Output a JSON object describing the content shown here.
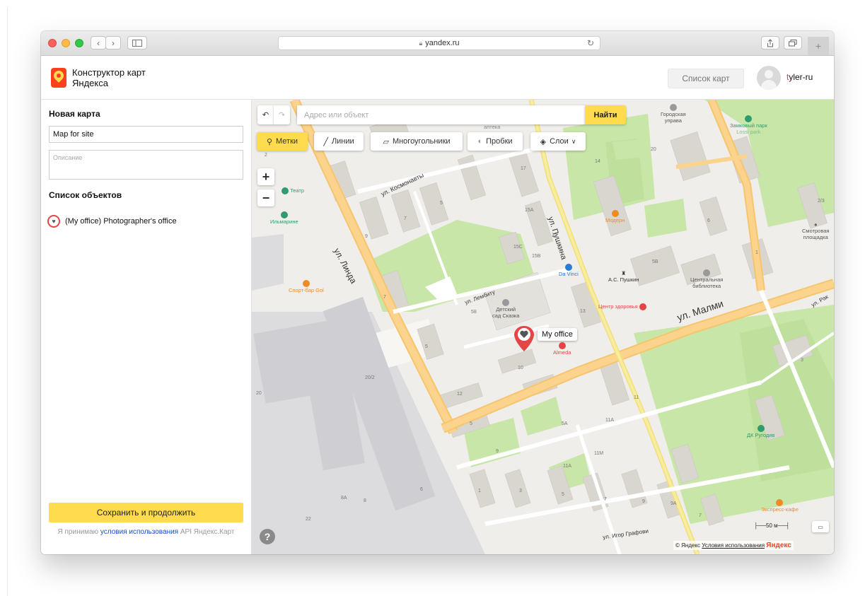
{
  "browser": {
    "url": "yandex.ru"
  },
  "app": {
    "title_line1": "Конструктор карт",
    "title_line2": "Яндекса",
    "maps_list_button": "Список карт",
    "username_first": "t",
    "username_rest": "yler-ru"
  },
  "sidebar": {
    "new_map_heading": "Новая карта",
    "map_name_value": "Map for site",
    "description_placeholder": "Описание",
    "objects_heading": "Список объектов",
    "object_item": "(My office) Photographer's office",
    "save_button": "Сохранить и продолжить",
    "terms_prefix": "Я принимаю ",
    "terms_link": "условия использования",
    "terms_suffix": " API Яндекс.Карт"
  },
  "map": {
    "search_placeholder": "Адрес или объект",
    "find_button": "Найти",
    "tools": {
      "marks": "Метки",
      "lines": "Линии",
      "polygons": "Многоугольники",
      "traffic": "Пробки",
      "layers": "Слои"
    },
    "marker_label": "My office",
    "streets": {
      "linda": "ул. Линда",
      "pushkina": "ул. Пушкина",
      "malmi": "ул. Малми",
      "kosmonavty": "ул. Космонавты",
      "lembitu": "ул. Лембиту",
      "igor": "ул. Игор Графови",
      "rak": "ул. Рак"
    },
    "pois": {
      "teatr": "Театр",
      "ilmarine": "Ильмарине",
      "sport_bar": "Спорт-бар Gol",
      "kindergarten_1": "Детский",
      "kindergarten_2": "сад Сказка",
      "da_vinci": "Da Vinci",
      "pushkin": "А.С. Пушкин",
      "health_center": "Центр здоровья",
      "library_1": "Центральная",
      "library_2": "библиотека",
      "moderne": "Модерн",
      "almeda": "Almeda",
      "town_admin_1": "Городская",
      "town_admin_2": "управа",
      "castle_park_1": "Замковый парк",
      "castle_park_2": "Lossi park",
      "observation_1": "Смотровая",
      "observation_2": "площадка",
      "dk": "ДК Ругодив",
      "express_cafe": "Экспресс-кафе",
      "apteka": "аптека"
    },
    "house_numbers": [
      "2",
      "7",
      "9",
      "5",
      "15A",
      "17",
      "15",
      "15C",
      "15B",
      "14",
      "20",
      "5B",
      "6",
      "1",
      "2/3",
      "7",
      "58",
      "13",
      "5",
      "10",
      "12",
      "11",
      "5A",
      "11A",
      "9",
      "11M",
      "11A",
      "5",
      "1",
      "3",
      "5",
      "7",
      "9",
      "9A",
      "7",
      "20/2",
      "20",
      "8A",
      "8",
      "22",
      "6",
      "3"
    ],
    "scale": "50 м",
    "copyright_brand": "© Яндекс",
    "copyright_terms": "Условия использования",
    "yandex_logo": "Яндекс"
  },
  "colors": {
    "accent_yellow": "#ffdb4d",
    "yandex_red": "#fc3f1d",
    "road_orange": "#fbd38c",
    "park_green": "#c8e6a7"
  }
}
